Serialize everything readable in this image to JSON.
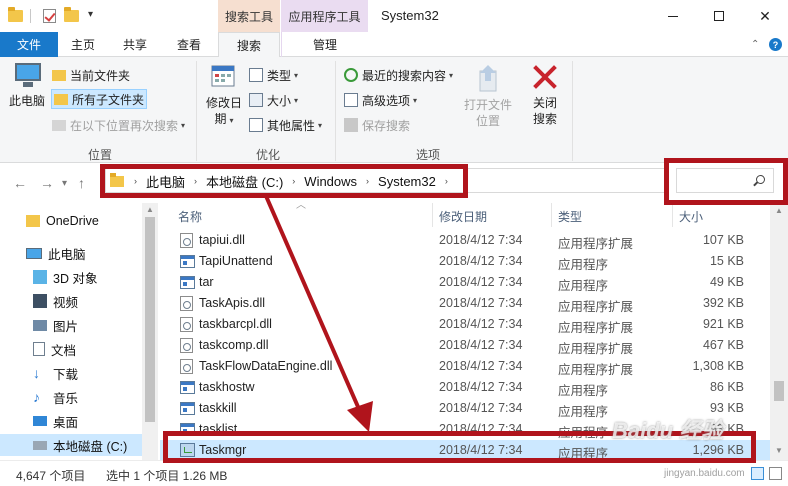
{
  "window": {
    "title": "System32",
    "context_tabs": [
      "搜索工具",
      "应用程序工具"
    ]
  },
  "ribbon_tabs": {
    "file": "文件",
    "home": "主页",
    "share": "共享",
    "view": "查看",
    "search": "搜索",
    "manage": "管理"
  },
  "ribbon": {
    "location": {
      "this_pc": "此电脑",
      "current_folder": "当前文件夹",
      "all_subfolders": "所有子文件夹",
      "search_again": "在以下位置再次搜索",
      "label": "位置"
    },
    "refine": {
      "modified_date": "修改日期",
      "type": "类型",
      "size": "大小",
      "other_props": "其他属性",
      "label": "优化"
    },
    "options": {
      "recent_searches": "最近的搜索内容",
      "advanced": "高级选项",
      "save_search": "保存搜索",
      "open_location": "打开文件位置",
      "close_search": "关闭搜索",
      "label": "选项"
    }
  },
  "address": {
    "crumbs": [
      "此电脑",
      "本地磁盘 (C:)",
      "Windows",
      "System32"
    ],
    "search_placeholder": ""
  },
  "nav_pane": [
    {
      "label": "OneDrive",
      "icon": "folder-icon"
    },
    {
      "label": "此电脑",
      "icon": "computer-icon"
    },
    {
      "label": "3D 对象",
      "icon": "cube-icon"
    },
    {
      "label": "视频",
      "icon": "video-icon"
    },
    {
      "label": "图片",
      "icon": "picture-icon"
    },
    {
      "label": "文档",
      "icon": "document-icon"
    },
    {
      "label": "下载",
      "icon": "download-icon"
    },
    {
      "label": "音乐",
      "icon": "music-icon"
    },
    {
      "label": "桌面",
      "icon": "desktop-icon"
    },
    {
      "label": "本地磁盘 (C:)",
      "icon": "drive-icon"
    }
  ],
  "columns": {
    "name": "名称",
    "date": "修改日期",
    "type": "类型",
    "size": "大小"
  },
  "files": [
    {
      "name": "tapiui.dll",
      "date": "2018/4/12 7:34",
      "type": "应用程序扩展",
      "size": "107 KB",
      "icon": "dll"
    },
    {
      "name": "TapiUnattend",
      "date": "2018/4/12 7:34",
      "type": "应用程序",
      "size": "15 KB",
      "icon": "exe"
    },
    {
      "name": "tar",
      "date": "2018/4/12 7:34",
      "type": "应用程序",
      "size": "49 KB",
      "icon": "exe"
    },
    {
      "name": "TaskApis.dll",
      "date": "2018/4/12 7:34",
      "type": "应用程序扩展",
      "size": "392 KB",
      "icon": "dll"
    },
    {
      "name": "taskbarcpl.dll",
      "date": "2018/4/12 7:34",
      "type": "应用程序扩展",
      "size": "921 KB",
      "icon": "dll"
    },
    {
      "name": "taskcomp.dll",
      "date": "2018/4/12 7:34",
      "type": "应用程序扩展",
      "size": "467 KB",
      "icon": "dll"
    },
    {
      "name": "TaskFlowDataEngine.dll",
      "date": "2018/4/12 7:34",
      "type": "应用程序扩展",
      "size": "1,308 KB",
      "icon": "dll"
    },
    {
      "name": "taskhostw",
      "date": "2018/4/12 7:34",
      "type": "应用程序",
      "size": "86 KB",
      "icon": "exe"
    },
    {
      "name": "taskkill",
      "date": "2018/4/12 7:34",
      "type": "应用程序",
      "size": "93 KB",
      "icon": "exe"
    },
    {
      "name": "tasklist",
      "date": "2018/4/12 7:34",
      "type": "应用程序",
      "size": "93 KB",
      "icon": "exe"
    },
    {
      "name": "Taskmgr",
      "date": "2018/4/12 7:34",
      "type": "应用程序",
      "size": "1,296 KB",
      "icon": "mgr"
    }
  ],
  "status": {
    "count": "4,647 个项目",
    "selected": "选中 1 个项目  1.26 MB"
  },
  "watermark": {
    "brand": "Baidu 经验",
    "url": "jingyan.baidu.com"
  },
  "colors": {
    "accent": "#1979ca",
    "selection": "#cce8ff",
    "annotation": "#b0141c"
  }
}
